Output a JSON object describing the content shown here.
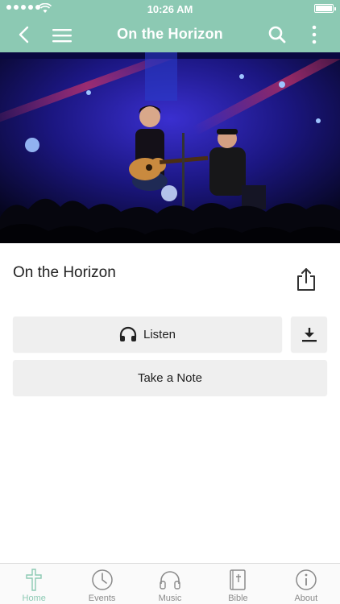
{
  "status_bar": {
    "time": "10:26 AM"
  },
  "nav": {
    "title": "On the Horizon"
  },
  "sermon": {
    "title": "On the Horizon"
  },
  "actions": {
    "listen_label": "Listen",
    "note_label": "Take a Note"
  },
  "tabs": [
    {
      "label": "Home",
      "icon": "cross-icon",
      "active": true
    },
    {
      "label": "Events",
      "icon": "clock-icon",
      "active": false
    },
    {
      "label": "Music",
      "icon": "headphones-icon",
      "active": false
    },
    {
      "label": "Bible",
      "icon": "bible-icon",
      "active": false
    },
    {
      "label": "About",
      "icon": "info-icon",
      "active": false
    }
  ],
  "colors": {
    "accent": "#8cc9b3",
    "button_bg": "#efefef",
    "inactive_tab": "#8a8a8a"
  }
}
